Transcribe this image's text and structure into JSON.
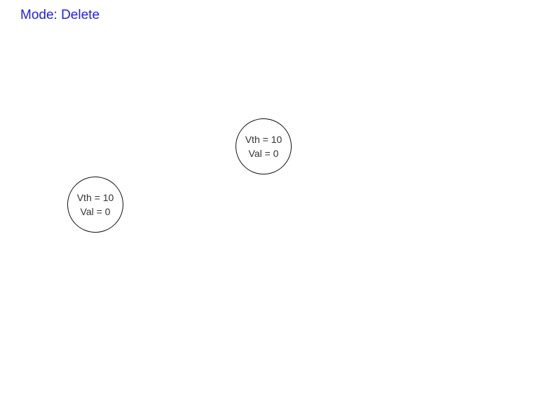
{
  "mode": {
    "text": "Mode: Delete",
    "color": "#1f1fe6"
  },
  "neurons": [
    {
      "vth_text": "Vth = 10",
      "val_text": "Val = 0"
    },
    {
      "vth_text": "Vth = 10",
      "val_text": "Val = 0"
    }
  ]
}
